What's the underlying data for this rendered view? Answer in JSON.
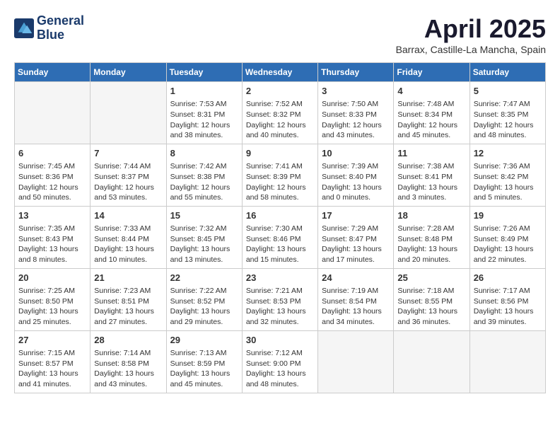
{
  "header": {
    "logo_line1": "General",
    "logo_line2": "Blue",
    "month_title": "April 2025",
    "location": "Barrax, Castille-La Mancha, Spain"
  },
  "weekdays": [
    "Sunday",
    "Monday",
    "Tuesday",
    "Wednesday",
    "Thursday",
    "Friday",
    "Saturday"
  ],
  "weeks": [
    [
      {
        "day": "",
        "info": ""
      },
      {
        "day": "",
        "info": ""
      },
      {
        "day": "1",
        "info": "Sunrise: 7:53 AM\nSunset: 8:31 PM\nDaylight: 12 hours\nand 38 minutes."
      },
      {
        "day": "2",
        "info": "Sunrise: 7:52 AM\nSunset: 8:32 PM\nDaylight: 12 hours\nand 40 minutes."
      },
      {
        "day": "3",
        "info": "Sunrise: 7:50 AM\nSunset: 8:33 PM\nDaylight: 12 hours\nand 43 minutes."
      },
      {
        "day": "4",
        "info": "Sunrise: 7:48 AM\nSunset: 8:34 PM\nDaylight: 12 hours\nand 45 minutes."
      },
      {
        "day": "5",
        "info": "Sunrise: 7:47 AM\nSunset: 8:35 PM\nDaylight: 12 hours\nand 48 minutes."
      }
    ],
    [
      {
        "day": "6",
        "info": "Sunrise: 7:45 AM\nSunset: 8:36 PM\nDaylight: 12 hours\nand 50 minutes."
      },
      {
        "day": "7",
        "info": "Sunrise: 7:44 AM\nSunset: 8:37 PM\nDaylight: 12 hours\nand 53 minutes."
      },
      {
        "day": "8",
        "info": "Sunrise: 7:42 AM\nSunset: 8:38 PM\nDaylight: 12 hours\nand 55 minutes."
      },
      {
        "day": "9",
        "info": "Sunrise: 7:41 AM\nSunset: 8:39 PM\nDaylight: 12 hours\nand 58 minutes."
      },
      {
        "day": "10",
        "info": "Sunrise: 7:39 AM\nSunset: 8:40 PM\nDaylight: 13 hours\nand 0 minutes."
      },
      {
        "day": "11",
        "info": "Sunrise: 7:38 AM\nSunset: 8:41 PM\nDaylight: 13 hours\nand 3 minutes."
      },
      {
        "day": "12",
        "info": "Sunrise: 7:36 AM\nSunset: 8:42 PM\nDaylight: 13 hours\nand 5 minutes."
      }
    ],
    [
      {
        "day": "13",
        "info": "Sunrise: 7:35 AM\nSunset: 8:43 PM\nDaylight: 13 hours\nand 8 minutes."
      },
      {
        "day": "14",
        "info": "Sunrise: 7:33 AM\nSunset: 8:44 PM\nDaylight: 13 hours\nand 10 minutes."
      },
      {
        "day": "15",
        "info": "Sunrise: 7:32 AM\nSunset: 8:45 PM\nDaylight: 13 hours\nand 13 minutes."
      },
      {
        "day": "16",
        "info": "Sunrise: 7:30 AM\nSunset: 8:46 PM\nDaylight: 13 hours\nand 15 minutes."
      },
      {
        "day": "17",
        "info": "Sunrise: 7:29 AM\nSunset: 8:47 PM\nDaylight: 13 hours\nand 17 minutes."
      },
      {
        "day": "18",
        "info": "Sunrise: 7:28 AM\nSunset: 8:48 PM\nDaylight: 13 hours\nand 20 minutes."
      },
      {
        "day": "19",
        "info": "Sunrise: 7:26 AM\nSunset: 8:49 PM\nDaylight: 13 hours\nand 22 minutes."
      }
    ],
    [
      {
        "day": "20",
        "info": "Sunrise: 7:25 AM\nSunset: 8:50 PM\nDaylight: 13 hours\nand 25 minutes."
      },
      {
        "day": "21",
        "info": "Sunrise: 7:23 AM\nSunset: 8:51 PM\nDaylight: 13 hours\nand 27 minutes."
      },
      {
        "day": "22",
        "info": "Sunrise: 7:22 AM\nSunset: 8:52 PM\nDaylight: 13 hours\nand 29 minutes."
      },
      {
        "day": "23",
        "info": "Sunrise: 7:21 AM\nSunset: 8:53 PM\nDaylight: 13 hours\nand 32 minutes."
      },
      {
        "day": "24",
        "info": "Sunrise: 7:19 AM\nSunset: 8:54 PM\nDaylight: 13 hours\nand 34 minutes."
      },
      {
        "day": "25",
        "info": "Sunrise: 7:18 AM\nSunset: 8:55 PM\nDaylight: 13 hours\nand 36 minutes."
      },
      {
        "day": "26",
        "info": "Sunrise: 7:17 AM\nSunset: 8:56 PM\nDaylight: 13 hours\nand 39 minutes."
      }
    ],
    [
      {
        "day": "27",
        "info": "Sunrise: 7:15 AM\nSunset: 8:57 PM\nDaylight: 13 hours\nand 41 minutes."
      },
      {
        "day": "28",
        "info": "Sunrise: 7:14 AM\nSunset: 8:58 PM\nDaylight: 13 hours\nand 43 minutes."
      },
      {
        "day": "29",
        "info": "Sunrise: 7:13 AM\nSunset: 8:59 PM\nDaylight: 13 hours\nand 45 minutes."
      },
      {
        "day": "30",
        "info": "Sunrise: 7:12 AM\nSunset: 9:00 PM\nDaylight: 13 hours\nand 48 minutes."
      },
      {
        "day": "",
        "info": ""
      },
      {
        "day": "",
        "info": ""
      },
      {
        "day": "",
        "info": ""
      }
    ]
  ]
}
